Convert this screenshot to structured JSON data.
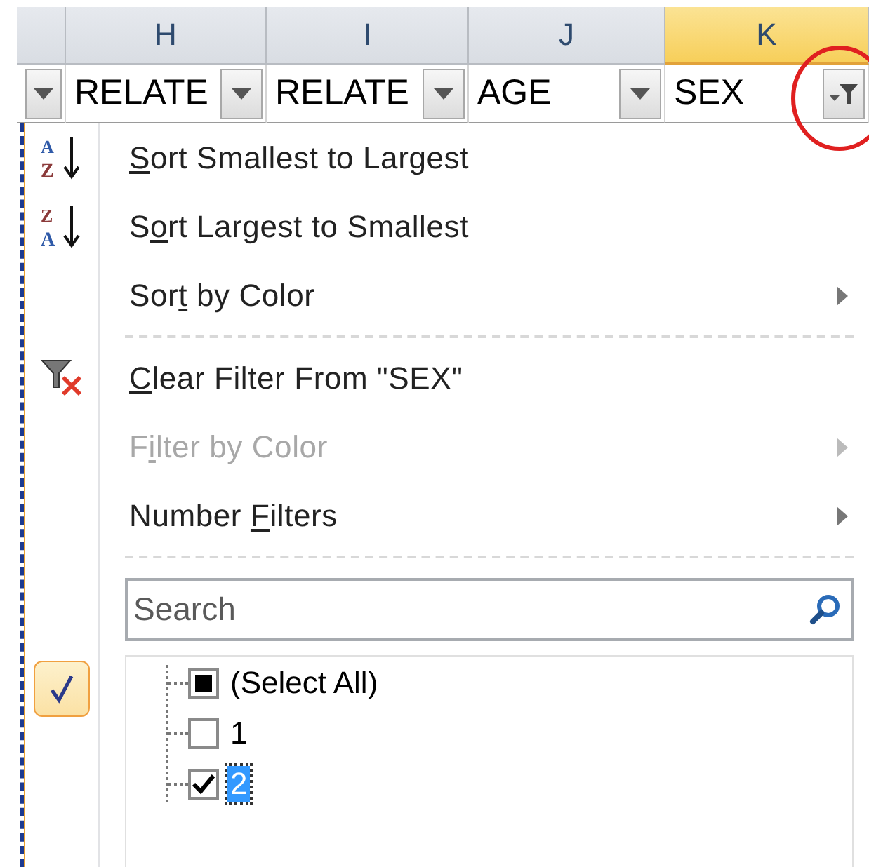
{
  "columns": [
    {
      "selected": false
    },
    {
      "label": "H",
      "selected": false
    },
    {
      "label": "I",
      "selected": false
    },
    {
      "label": "J",
      "selected": false
    },
    {
      "label": "K",
      "selected": true
    }
  ],
  "filter_row": [
    {
      "filtered": false
    },
    {
      "text": "RELATE",
      "filtered": false
    },
    {
      "text": "RELATE",
      "filtered": false
    },
    {
      "text": "AGE",
      "filtered": false
    },
    {
      "text": "SEX",
      "filtered": true
    }
  ],
  "menu": [
    {
      "kind": "item",
      "icon_text": [
        "A",
        "Z"
      ],
      "key": "S",
      "after": "ort Smallest to Largest",
      "submenu": false,
      "disabled": false
    },
    {
      "kind": "item",
      "icon_text": [
        "Z",
        "A"
      ],
      "before": "S",
      "key": "o",
      "after": "rt Largest to Smallest",
      "submenu": false,
      "disabled": false
    },
    {
      "kind": "item",
      "before": "Sor",
      "key": "t",
      "after": " by Color",
      "submenu": true,
      "disabled": false
    },
    {
      "kind": "separator"
    },
    {
      "kind": "item",
      "key": "C",
      "after": "lear Filter From \"SEX\"",
      "submenu": false,
      "disabled": false
    },
    {
      "kind": "item",
      "before": "F",
      "key": "i",
      "after": "lter by Color",
      "submenu": true,
      "disabled": true
    },
    {
      "kind": "item",
      "before": "Number ",
      "key": "F",
      "after": "ilters",
      "submenu": true,
      "disabled": false
    },
    {
      "kind": "separator"
    }
  ],
  "search": {
    "placeholder": "Search"
  },
  "values_filtered": true,
  "values": [
    {
      "label": "(Select All)",
      "partial": true,
      "selected": false
    },
    {
      "label": "1",
      "checked": false,
      "selected": false
    },
    {
      "label": "2",
      "checked": true,
      "selected": true
    }
  ]
}
